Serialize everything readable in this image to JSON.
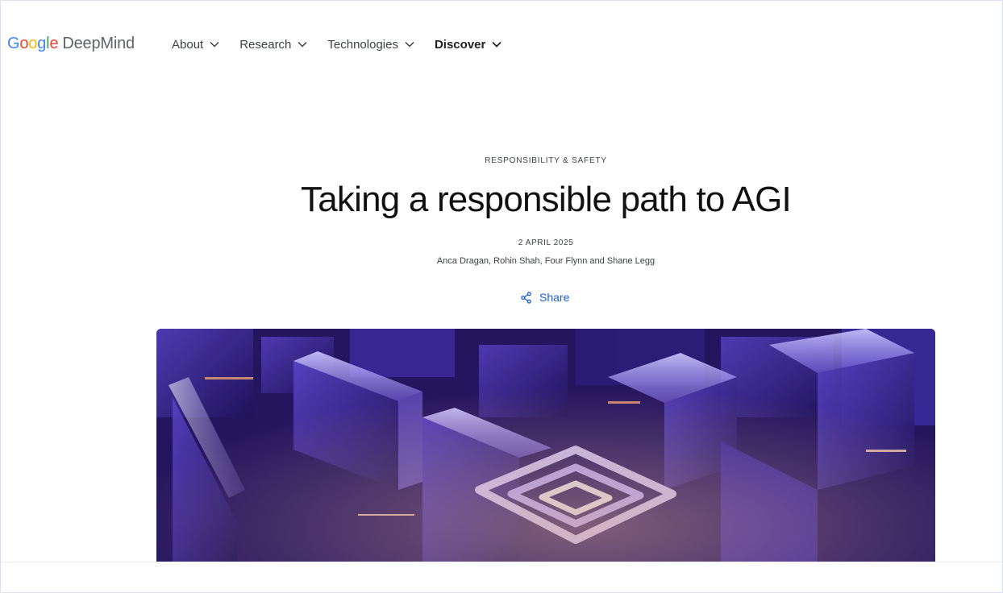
{
  "brand": {
    "google_letters": [
      {
        "ch": "G",
        "color": "#4285F4"
      },
      {
        "ch": "o",
        "color": "#EA4335"
      },
      {
        "ch": "o",
        "color": "#FBBC05"
      },
      {
        "ch": "g",
        "color": "#4285F4"
      },
      {
        "ch": "l",
        "color": "#34A853"
      },
      {
        "ch": "e",
        "color": "#EA4335"
      }
    ],
    "product": "DeepMind"
  },
  "nav": {
    "items": [
      {
        "label": "About",
        "icon": "chevron-down-icon"
      },
      {
        "label": "Research",
        "icon": "chevron-down-icon"
      },
      {
        "label": "Technologies",
        "icon": "chevron-down-icon"
      },
      {
        "label": "Discover",
        "icon": "chevron-down-icon"
      }
    ]
  },
  "article": {
    "category": "RESPONSIBILITY & SAFETY",
    "title": "Taking a responsible path to AGI",
    "date": "2 APRIL 2025",
    "authors": "Anca Dragan, Rohin Shah, Four Flynn and Shane Legg",
    "share_label": "Share",
    "share_icon": "share-icon"
  },
  "hero": {
    "description_icon": "abstract-crystal-maze-image",
    "colors": {
      "base": "#3a2596",
      "glow": "#8a7cff",
      "accent": "#f0a070"
    }
  },
  "colors": {
    "link_blue": "#1a5fd6",
    "text": "#1f1f1f",
    "muted": "#3c4043"
  }
}
